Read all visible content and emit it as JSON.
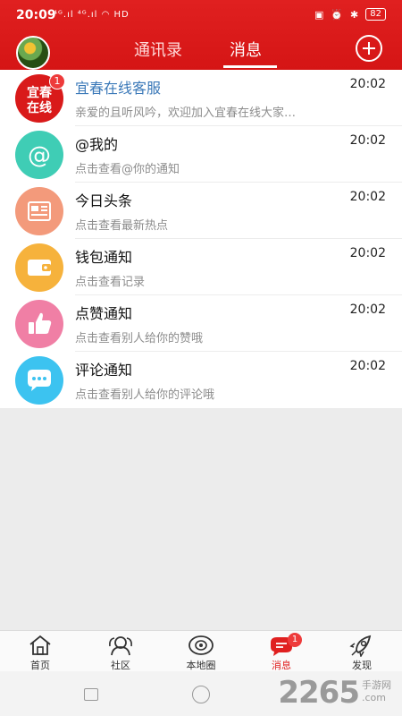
{
  "status": {
    "time": "20:09",
    "left_icons": "⁴ᴳ.ıl ⁴ᴳ.ıl ◠ HD",
    "battery": "82"
  },
  "header": {
    "tabs": [
      "通讯录",
      "消息"
    ],
    "active_tab": 1
  },
  "colors": {
    "brand_red": "#e02020",
    "title_blue": "#3a78b8"
  },
  "messages": [
    {
      "icon": "yichun-logo-icon",
      "icon_text_1": "宜春",
      "icon_text_2": "在线",
      "title": "宜春在线客服",
      "subtitle": "亲爱的且听风吟，欢迎加入宜春在线大家…",
      "time": "20:02",
      "badge": "1"
    },
    {
      "icon": "at-icon",
      "title": "@我的",
      "subtitle": "点击查看@你的通知",
      "time": "20:02"
    },
    {
      "icon": "news-icon",
      "title": "今日头条",
      "subtitle": "点击查看最新热点",
      "time": "20:02"
    },
    {
      "icon": "wallet-icon",
      "title": "钱包通知",
      "subtitle": "点击查看记录",
      "time": "20:02"
    },
    {
      "icon": "thumbs-up-icon",
      "title": "点赞通知",
      "subtitle": "点击查看别人给你的赞哦",
      "time": "20:02"
    },
    {
      "icon": "comment-icon",
      "title": "评论通知",
      "subtitle": "点击查看别人给你的评论哦",
      "time": "20:02"
    }
  ],
  "tabbar": {
    "items": [
      {
        "icon": "home-icon",
        "label": "首页"
      },
      {
        "icon": "community-icon",
        "label": "社区"
      },
      {
        "icon": "local-circle-icon",
        "label": "本地圈"
      },
      {
        "icon": "message-icon",
        "label": "消息",
        "badge": "1"
      },
      {
        "icon": "rocket-icon",
        "label": "发现"
      }
    ],
    "active": 3
  },
  "watermark": {
    "number": "2265",
    "suffix": ".com",
    "site": "手游网"
  }
}
